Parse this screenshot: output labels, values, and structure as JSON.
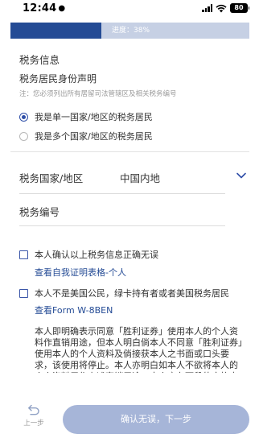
{
  "status_bar": {
    "time": "12:44",
    "battery": "80"
  },
  "progress": {
    "label": "进度：38%",
    "fraction": 0.38
  },
  "tax_info": {
    "section_title": "税务信息",
    "declaration_title": "税务居民身份声明",
    "note": "注：您必须列出所有居留司法管辖区及相关税务编号",
    "options": [
      {
        "label": "我是单一国家/地区的税务居民",
        "selected": true
      },
      {
        "label": "我是多个国家/地区的税务居民",
        "selected": false
      }
    ]
  },
  "form": {
    "country_label": "税务国家/地区",
    "country_value": "中国内地",
    "tax_number_label": "税务编号"
  },
  "confirmations": [
    {
      "text": "本人确认以上税务信息正确无误",
      "link": "查看自我证明表格-个人"
    },
    {
      "text": "本人不是美国公民，绿卡持有者或者美国税务居民",
      "link": "查看Form W-8BEN"
    }
  ],
  "consent_paragraph": "本人即明确表示同意「胜利证券」使用本人的个人资料作直销用途，但本人明白倘本人不同意「胜利证券」使用本人的个人资料及倘接获本人之书面或口头要求，该使用将停止。本人亦明白如本人不欲将本人的个人资料用作上述直销用途，本人应在下段的方格内勾选，以表示不同意。",
  "bottom": {
    "back_label": "上一步",
    "next_label": "确认无误，下一步"
  },
  "colors": {
    "brand": "#244b95",
    "progress_track": "#c6d0e4",
    "next_button": "#a6b5d8"
  }
}
